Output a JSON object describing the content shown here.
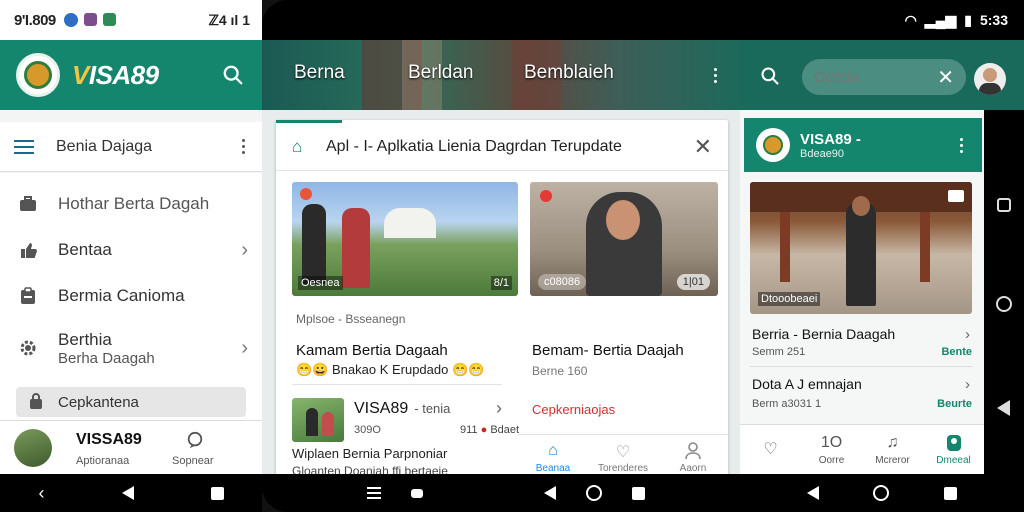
{
  "left_phone": {
    "status": {
      "time": "9'I.809",
      "right": "ℤ4 ıl 1"
    },
    "header": {
      "brand_prefix": "V",
      "brand": "ISA89"
    },
    "subbar": {
      "title": "Benia Dajaga"
    },
    "menu": [
      {
        "label": "Hothar Berta Dagah"
      },
      {
        "label": "Bentaa"
      },
      {
        "label": "Bermia Canioma"
      },
      {
        "label": "Berthia",
        "sublabel": "Berha Daagah"
      },
      {
        "label": "Cepkantena"
      }
    ],
    "bottom": {
      "brand": "VISSA89",
      "sub": "Aptioranaa",
      "action": "Sopnear"
    }
  },
  "middle_phone": {
    "header_tabs": [
      "Berna",
      "Berldan",
      "Bemblaieh"
    ],
    "card_title": "Apl - I- Aplkatia Lienia Dagrdan   Terupdate",
    "img_a": {
      "cap_left": "Oesnea",
      "cap_right": "8/1"
    },
    "img_b": {
      "pill_left": "c08086",
      "pill_right": "1|01"
    },
    "meta": "Mplsoe  -  Bsseanegn",
    "headline_1": "Kamam Bertia Dagaah",
    "headline_1b": "😁😀 Bnakao K Erupdado 😁😁",
    "headline_2": "Bemam- Bertia Daajah",
    "headline_2b": "Berne 160",
    "row": {
      "title": "VISA89",
      "title_sub": "- tenia",
      "meta_left": "309O",
      "meta_right_num": "911",
      "meta_right_label": "Bdaet",
      "line3": "Wiplaen   Bernia Parpnoniar",
      "line4": "Gloanten   Doanjah ffi bertaeie"
    },
    "link": "Cepkerniaojas",
    "tabs": [
      {
        "label": "Beanaa"
      },
      {
        "label": "Torenderes"
      },
      {
        "label": "Aaorn"
      }
    ]
  },
  "right_phone": {
    "status": {
      "time": "5:33"
    },
    "search": {
      "placeholder": "Oceda"
    },
    "card": {
      "title": "VISA89 -",
      "sub": "Bdeae90"
    },
    "img_caption": "Dtooobeaei",
    "rows": [
      {
        "title": "Berria - Bernia Daagah",
        "sub": "Semm 251",
        "tag": "Bente"
      },
      {
        "title": "Dota A J emnajan",
        "sub": "Berm a3031 1",
        "tag": "Beurte"
      }
    ],
    "tabs": [
      {
        "label": ""
      },
      {
        "label": "Oorre"
      },
      {
        "label": "Mcreror"
      },
      {
        "label": "Dmeeal"
      }
    ],
    "tab_counter": "1O"
  }
}
